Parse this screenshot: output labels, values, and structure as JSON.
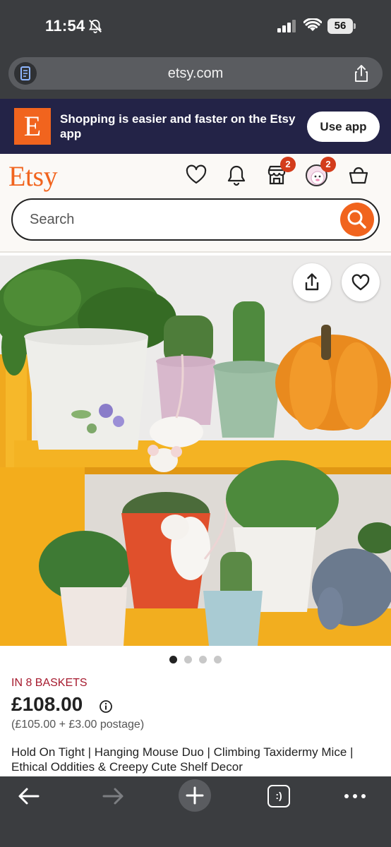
{
  "status_bar": {
    "time": "11:54",
    "battery_level": "56",
    "icons": [
      "bell-off-icon",
      "cellular-signal-icon",
      "wifi-icon",
      "battery-icon"
    ]
  },
  "browser": {
    "url": "etsy.com",
    "icons": [
      "reader-mode-icon",
      "share-icon"
    ]
  },
  "app_banner": {
    "logo_letter": "E",
    "message": "Shopping is easier and faster on the Etsy app",
    "button_label": "Use app"
  },
  "header": {
    "logo": "Etsy",
    "search_placeholder": "Search",
    "icons": [
      "heart-icon",
      "bell-icon",
      "shop-icon",
      "avatar",
      "basket-icon"
    ],
    "shop_badge": "2",
    "avatar_badge": "2"
  },
  "product": {
    "image_description_icons": [
      "share-icon",
      "heart-icon"
    ],
    "carousel_total": 4,
    "carousel_active": 1,
    "baskets_text": "IN 8 BASKETS",
    "price": "£108.00",
    "price_breakdown": "(£105.00 + £3.00 postage)",
    "title": "Hold On Tight | Hanging Mouse Duo | Climbing Taxidermy Mice | Ethical Oddities & Creepy Cute Shelf Decor"
  },
  "toolbar": {
    "icons": [
      "back-arrow-icon",
      "forward-arrow-icon",
      "new-tab-plus-icon",
      "tabs-icon",
      "more-icon"
    ],
    "tabs_label": ":)"
  },
  "colors": {
    "etsy_orange": "#f1641e",
    "banner_navy": "#232347",
    "chrome_gray": "#3b3d40",
    "baskets_red": "#a61a2e",
    "badge_red": "#d33c1b"
  }
}
